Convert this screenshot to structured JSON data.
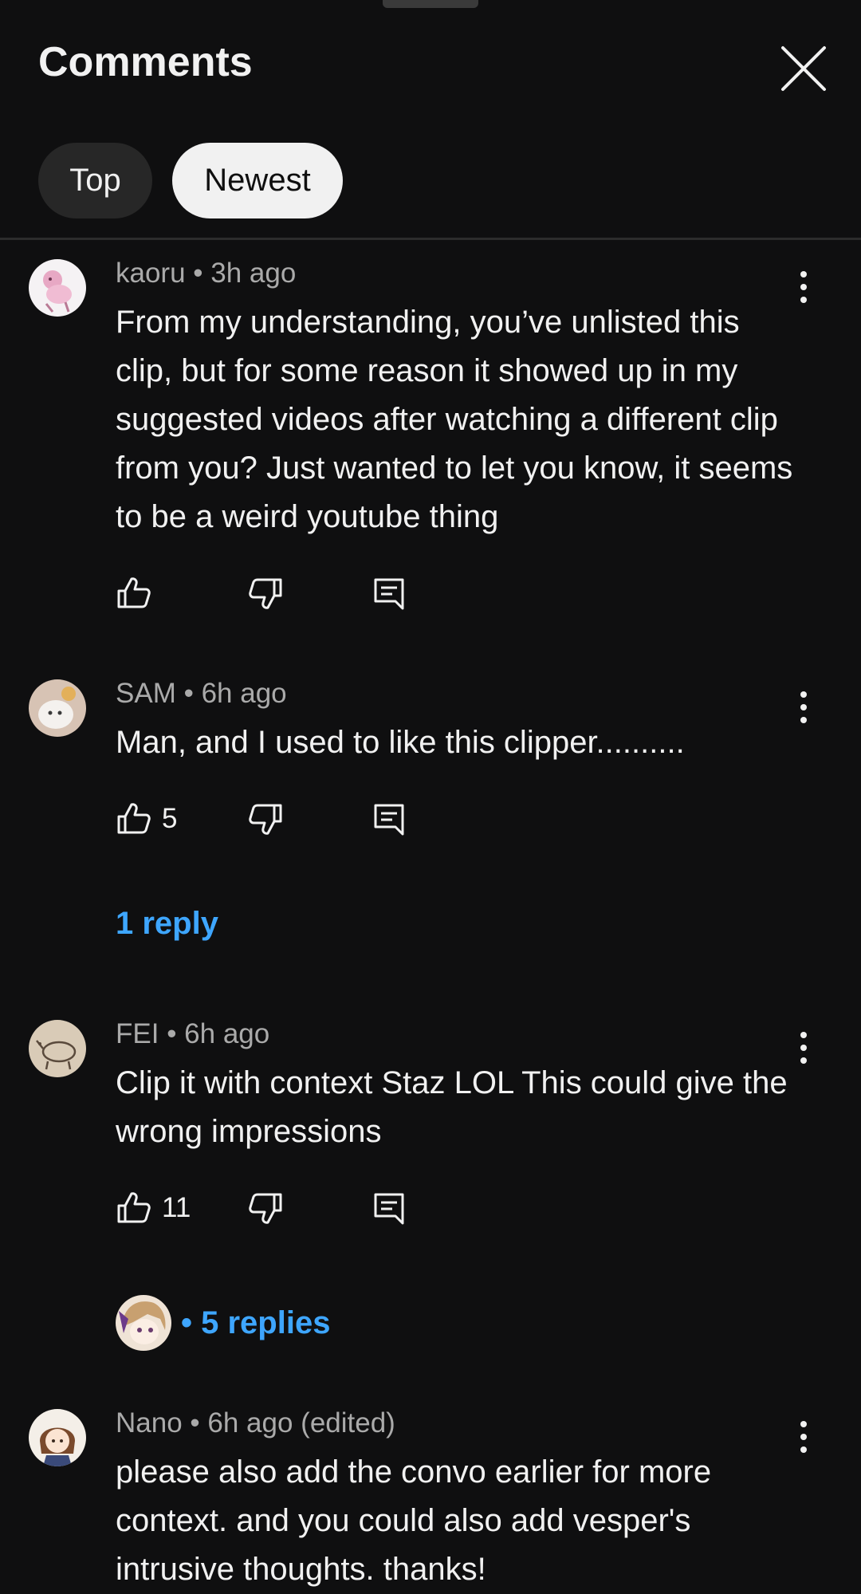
{
  "header": {
    "title": "Comments"
  },
  "filters": [
    {
      "label": "Top",
      "selected": false
    },
    {
      "label": "Newest",
      "selected": true
    }
  ],
  "comments": [
    {
      "author": "kaoru",
      "time": "3h ago",
      "text": "From my understanding, you’ve unlisted this clip, but for some reason it showed up in my suggested videos after watching a different clip from you? Just wanted to let you know, it seems to be a weird youtube thing",
      "likes": ""
    },
    {
      "author": "SAM",
      "time": "6h ago",
      "text": "Man, and I used to like this clipper..........",
      "likes": "5",
      "replies_label": "1 reply"
    },
    {
      "author": "FEI",
      "time": "6h ago",
      "text": "Clip it with context Staz LOL This could give the wrong impressions",
      "likes": "11",
      "replies_label": "• 5 replies"
    },
    {
      "author": "Nano",
      "time": "6h ago (edited)",
      "text": "please also add the convo earlier for more context. and you could also add vesper's intrusive thoughts. thanks!"
    }
  ],
  "icons": {
    "like": "thumbs-up-icon",
    "dislike": "thumbs-down-icon",
    "reply": "reply-icon",
    "more": "more-vert-icon",
    "close": "close-icon"
  },
  "colors": {
    "background": "#0f0f10",
    "link": "#3ea6ff",
    "meta": "#aaaaaa",
    "chip_active": "#f1f1f1",
    "chip_inactive": "#272727"
  }
}
